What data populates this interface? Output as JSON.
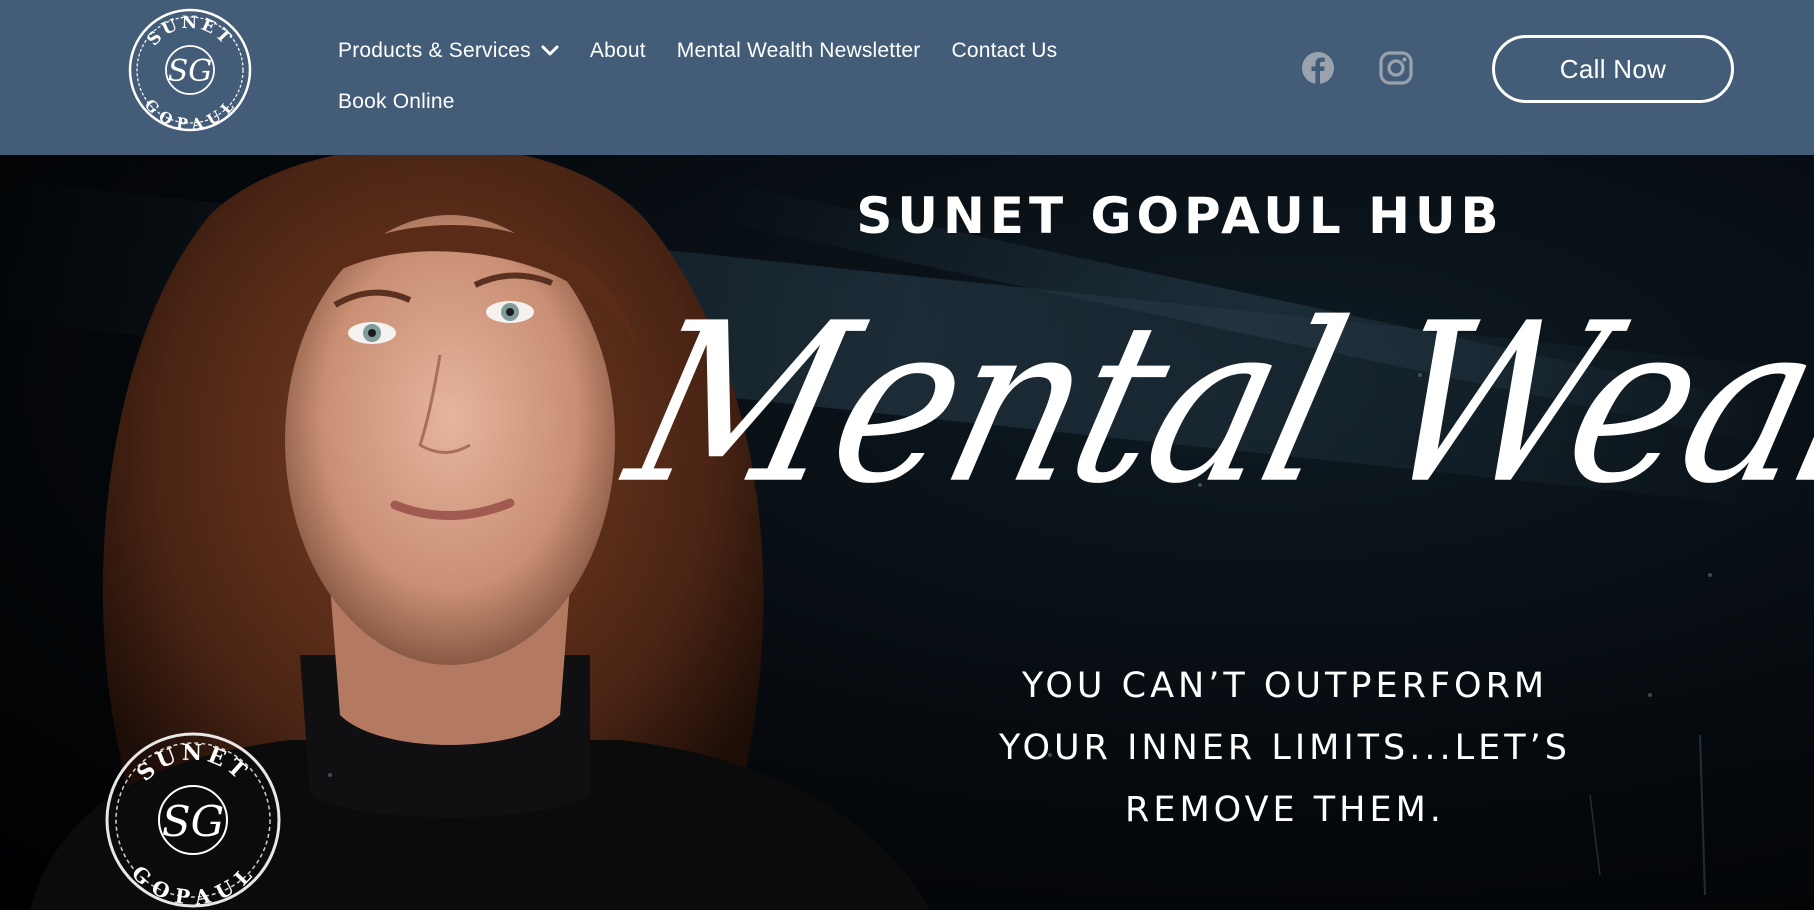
{
  "brand": {
    "logo_top_text": "SUNET",
    "logo_monogram": "SG",
    "logo_bottom_text": "GOPAUL"
  },
  "nav": {
    "items": [
      {
        "label": "Products & Services",
        "has_dropdown": true
      },
      {
        "label": "About"
      },
      {
        "label": "Mental Wealth Newsletter"
      },
      {
        "label": "Contact Us"
      },
      {
        "label": "Book Online"
      }
    ]
  },
  "social": {
    "facebook_icon": "facebook-icon",
    "instagram_icon": "instagram-icon"
  },
  "cta": {
    "call_label": "Call Now"
  },
  "hero": {
    "title": "SUNET GOPAUL HUB",
    "script_title": "Mental Wealth",
    "tagline_lines": [
      "YOU CAN’T OUTPERFORM",
      "YOUR INNER LIMITS...LET’S",
      "REMOVE THEM."
    ]
  },
  "colors": {
    "header_bg": "#435d79",
    "text": "#ffffff",
    "icon_muted": "#9aa3ad",
    "hero_bg": "#05090d"
  }
}
